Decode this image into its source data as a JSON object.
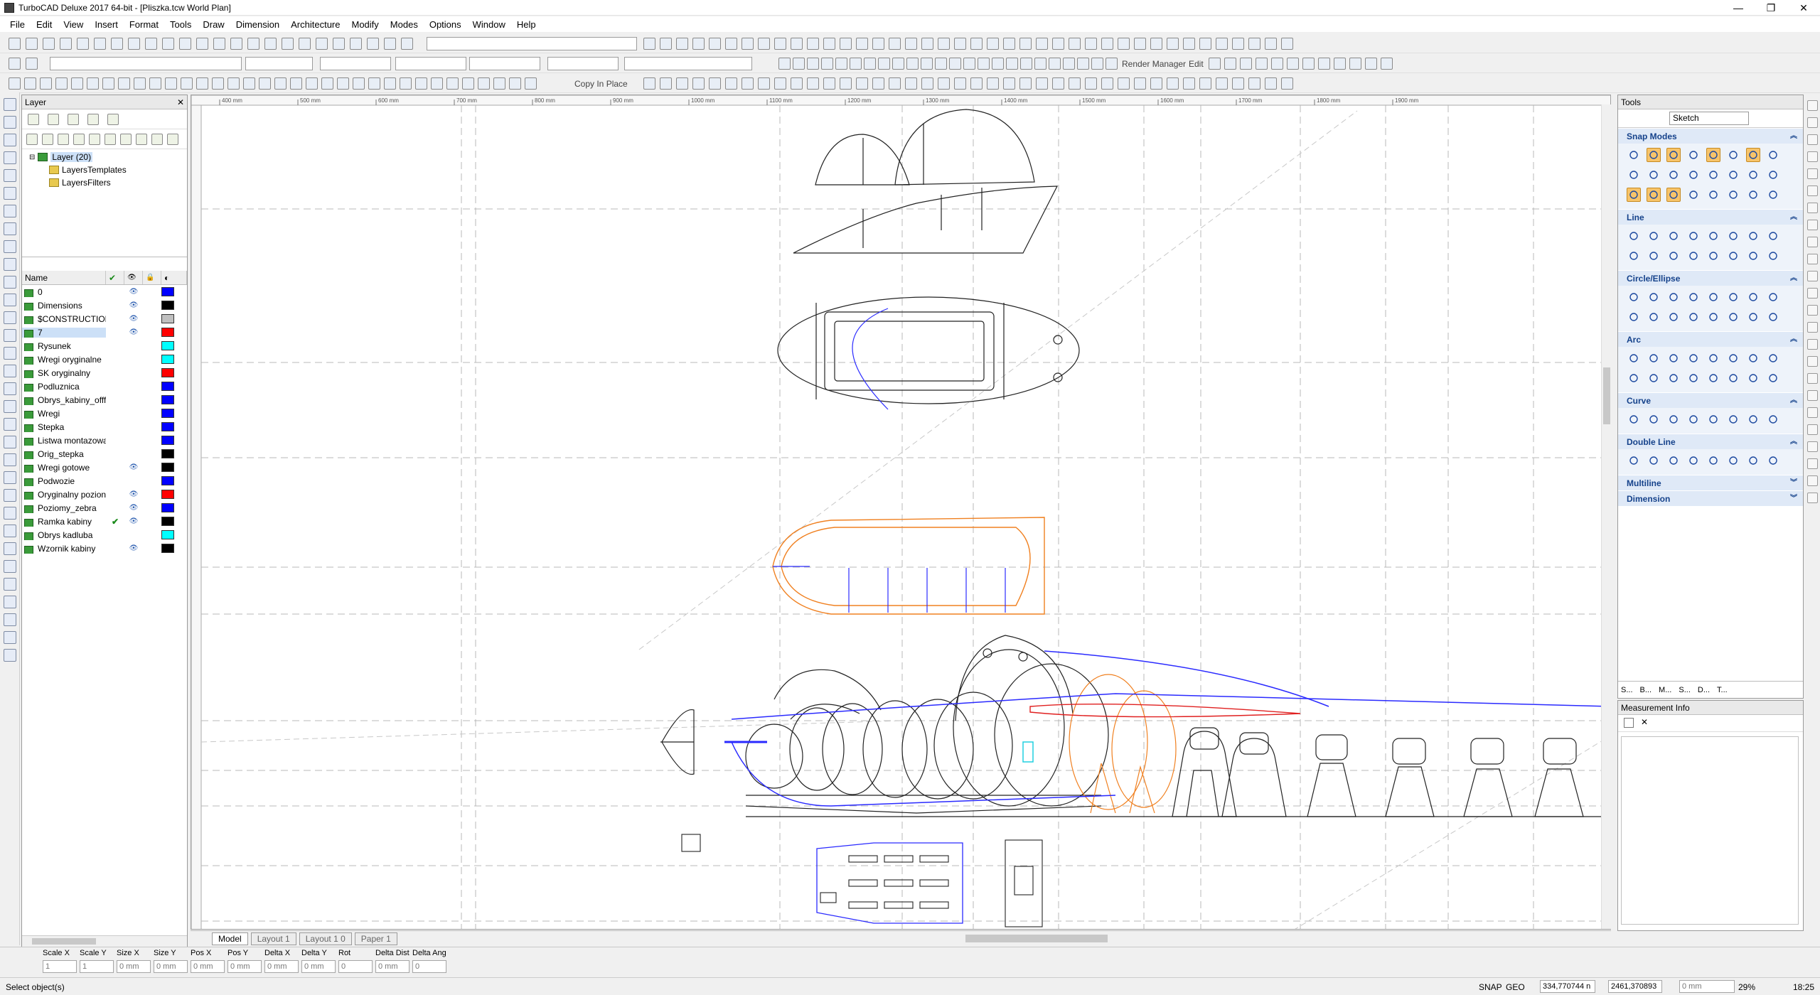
{
  "window": {
    "title": "TurboCAD Deluxe 2017 64-bit - [Pliszka.tcw World Plan]",
    "minimize": "—",
    "maximize": "❐",
    "close": "✕"
  },
  "menu": [
    "File",
    "Edit",
    "View",
    "Insert",
    "Format",
    "Tools",
    "Draw",
    "Dimension",
    "Architecture",
    "Modify",
    "Modes",
    "Options",
    "Window",
    "Help"
  ],
  "toolbar": {
    "render_manager": "Render Manager",
    "edit": "Edit",
    "copy_in_place": "Copy In Place"
  },
  "layer_panel": {
    "title": "Layer",
    "close": "✕",
    "tree": {
      "root": "Layer (20)",
      "children": [
        "LayersTemplates",
        "LayersFilters"
      ]
    },
    "columns": [
      "Name",
      "✔",
      "👁",
      "🔒",
      "◐"
    ],
    "layers": [
      {
        "name": "0",
        "current": false,
        "visible": true,
        "color": "#0000ff"
      },
      {
        "name": "Dimensions",
        "current": false,
        "visible": true,
        "color": "#000000"
      },
      {
        "name": "$CONSTRUCTION",
        "current": false,
        "visible": true,
        "color": "#c0c0c0"
      },
      {
        "name": "7",
        "current": false,
        "visible": true,
        "color": "#ff0000"
      },
      {
        "name": "Rysunek",
        "current": false,
        "visible": false,
        "color": "#00ffff"
      },
      {
        "name": "Wregi oryginalne",
        "current": false,
        "visible": false,
        "color": "#00ffff"
      },
      {
        "name": "SK oryginalny",
        "current": false,
        "visible": false,
        "color": "#ff0000"
      },
      {
        "name": "Podluznica",
        "current": false,
        "visible": false,
        "color": "#0000ff"
      },
      {
        "name": "Obrys_kabiny_offf",
        "current": false,
        "visible": false,
        "color": "#0000ff"
      },
      {
        "name": "Wregi",
        "current": false,
        "visible": false,
        "color": "#0000ff"
      },
      {
        "name": "Stepka",
        "current": false,
        "visible": false,
        "color": "#0000ff"
      },
      {
        "name": "Listwa montazowa",
        "current": false,
        "visible": false,
        "color": "#0000ff"
      },
      {
        "name": "Orig_stepka",
        "current": false,
        "visible": false,
        "color": "#000000"
      },
      {
        "name": "Wregi gotowe",
        "current": false,
        "visible": true,
        "color": "#000000"
      },
      {
        "name": "Podwozie",
        "current": false,
        "visible": false,
        "color": "#0000ff"
      },
      {
        "name": "Oryginalny pozion",
        "current": false,
        "visible": true,
        "color": "#ff0000"
      },
      {
        "name": "Poziomy_zebra",
        "current": false,
        "visible": true,
        "color": "#0000ff"
      },
      {
        "name": "Ramka kabiny",
        "current": true,
        "visible": true,
        "color": "#000000"
      },
      {
        "name": "Obrys kadluba",
        "current": false,
        "visible": false,
        "color": "#00ffff"
      },
      {
        "name": "Wzornik kabiny",
        "current": false,
        "visible": true,
        "color": "#000000"
      }
    ]
  },
  "ruler_labels": [
    "400 mm",
    "500 mm",
    "600 mm",
    "700 mm",
    "800 mm",
    "900 mm",
    "1000 mm",
    "1100 mm",
    "1200 mm",
    "1300 mm",
    "1400 mm",
    "1500 mm",
    "1600 mm",
    "1700 mm",
    "1800 mm",
    "1900 mm"
  ],
  "sheet_tabs": [
    "Model",
    "Layout 1",
    "Layout 1 0",
    "Paper 1"
  ],
  "tools_panel": {
    "title": "Tools",
    "palette": "Sketch",
    "sections": [
      {
        "name": "Snap Modes",
        "expanded": true
      },
      {
        "name": "Line",
        "expanded": true
      },
      {
        "name": "Circle/Ellipse",
        "expanded": true
      },
      {
        "name": "Arc",
        "expanded": true
      },
      {
        "name": "Curve",
        "expanded": true
      },
      {
        "name": "Double Line",
        "expanded": true
      },
      {
        "name": "Multiline",
        "expanded": false
      },
      {
        "name": "Dimension",
        "expanded": false
      }
    ],
    "bottom_tabs": [
      "S...",
      "B...",
      "M...",
      "S...",
      "D...",
      "T..."
    ]
  },
  "measurement": {
    "title": "Measurement Info",
    "close": "✕"
  },
  "inspector": {
    "fields": [
      {
        "label": "Scale X",
        "value": "1"
      },
      {
        "label": "Scale Y",
        "value": "1"
      },
      {
        "label": "Size X",
        "value": "0 mm"
      },
      {
        "label": "Size Y",
        "value": "0 mm"
      },
      {
        "label": "Pos X",
        "value": "0 mm"
      },
      {
        "label": "Pos Y",
        "value": "0 mm"
      },
      {
        "label": "Delta X",
        "value": "0 mm"
      },
      {
        "label": "Delta Y",
        "value": "0 mm"
      },
      {
        "label": "Rot",
        "value": "0"
      },
      {
        "label": "Delta Dist",
        "value": "0 mm"
      },
      {
        "label": "Delta Ang",
        "value": "0"
      }
    ]
  },
  "status": {
    "message": "Select object(s)",
    "snap": "SNAP",
    "geo": "GEO",
    "coord_x": "334,770744 n",
    "coord_y": "2461,370893",
    "z": "0 mm",
    "zoom": "29%",
    "time": "18:25"
  }
}
